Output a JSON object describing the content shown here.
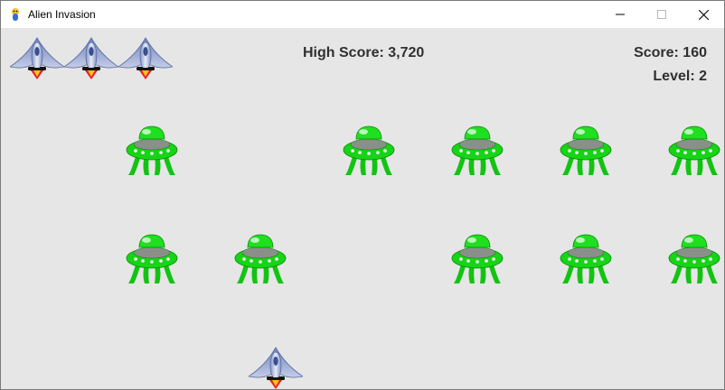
{
  "window": {
    "title": "Alien Invasion",
    "app_icon": "pygame-snake-icon"
  },
  "titlebar_buttons": {
    "minimize_icon": "minimize-icon",
    "maximize_icon": "maximize-icon",
    "close_icon": "close-icon"
  },
  "hud": {
    "high_score": "High Score: 3,720",
    "score": "Score: 160",
    "level": "Level: 2",
    "lives_remaining": 3
  },
  "aliens": {
    "grid_columns": 6,
    "grid_rows": 2,
    "alive": [
      [
        false,
        true,
        false,
        true,
        true,
        true,
        true
      ],
      [
        false,
        true,
        true,
        false,
        true,
        true,
        true
      ]
    ]
  },
  "colors": {
    "game_background": "#e6e6e6",
    "hud_text": "#303030",
    "alien_green": "#16d416",
    "ship_body": "#8fa0c8"
  }
}
